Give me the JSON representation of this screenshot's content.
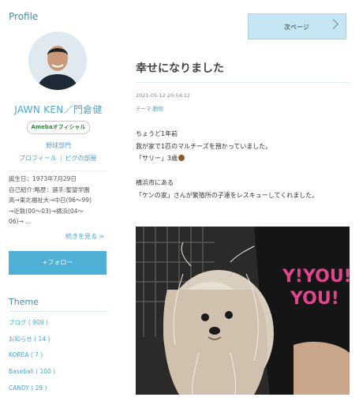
{
  "sidebar": {
    "profile_heading": "Profile",
    "name": "JAWN KEN／門倉健",
    "badge": "Amebaオフィシャル",
    "dept": "野球部門",
    "links": {
      "profile": "プロフィール",
      "room": "ピグの部屋"
    },
    "profile_lines": [
      "誕生日：1973年7月29日",
      "自己紹介:略歴：選手:聖望学園",
      "高→東北福祉大→中日(96〜99)",
      "→近鉄(00〜03)→横浜(04〜",
      "06)→ ..."
    ],
    "more": "続きを見る >",
    "follow": "+フォロー",
    "theme_heading": "Theme",
    "themes": [
      {
        "label": "ブログ ( 909 )"
      },
      {
        "label": "お知らせ ( 14 )"
      },
      {
        "label": "KOREA ( 7 )"
      },
      {
        "label": "Baseball ( 100 )"
      },
      {
        "label": "CANDY ( 29 )"
      }
    ]
  },
  "main": {
    "next_page": "次ページ",
    "title": "幸せになりました",
    "date": "2021-05-12 20:54:12",
    "theme_label": "テーマ:",
    "theme_value": "動物",
    "body_lines": [
      "ちょうど1年前",
      "我が家で1匹のマルチーズを預かっていました。",
      "「サリー」3歳",
      "",
      "横浜市にある",
      "「ケンの家」さんが繁殖所の子達をレスキューしてくれました。"
    ],
    "shirt_text": [
      "Y!YOU!",
      "YOU!"
    ]
  },
  "colors": {
    "accent": "#4aa8cf",
    "button": "#4fb0d6",
    "shirt_print": "#e0468e"
  },
  "icons": {
    "avatar": "avatar-photo",
    "emoji": "dog-face-emoji",
    "next": "chevron-right-icon"
  }
}
